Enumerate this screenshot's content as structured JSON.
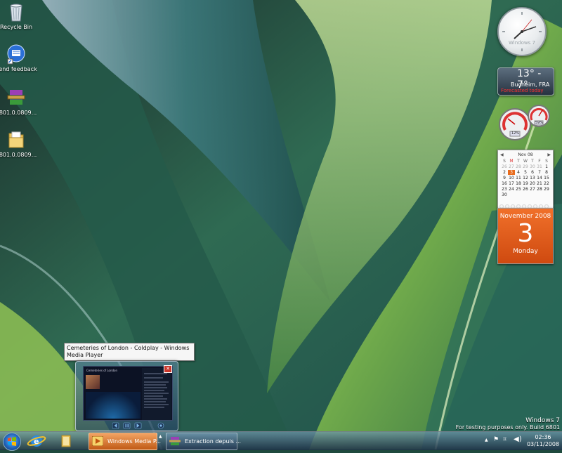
{
  "desktop": {
    "icons": [
      {
        "label": "Recycle Bin",
        "icon": "recycle-bin-icon"
      },
      {
        "label": "Send feedback",
        "icon": "feedback-icon"
      },
      {
        "label": "6801.0.0809...",
        "icon": "winrar-icon"
      },
      {
        "label": "6801.0.0809...",
        "icon": "folder-icon"
      }
    ]
  },
  "gadgets": {
    "clock": {
      "brand": "Windows 7"
    },
    "weather": {
      "temp": "13° - 7°",
      "location": "Bucheim, FRA",
      "forecast": "Forecasted today"
    },
    "meter": {
      "cpu_percent": "12%",
      "mem_percent": "59%"
    },
    "calendar": {
      "month": "Nov 08",
      "weekdays": [
        "S",
        "M",
        "T",
        "W",
        "T",
        "F",
        "S"
      ],
      "rows": [
        [
          "26",
          "27",
          "28",
          "29",
          "30",
          "31",
          "1"
        ],
        [
          "2",
          "3",
          "4",
          "5",
          "6",
          "7",
          "8"
        ],
        [
          "9",
          "10",
          "11",
          "12",
          "13",
          "14",
          "15"
        ],
        [
          "16",
          "17",
          "18",
          "19",
          "20",
          "21",
          "22"
        ],
        [
          "23",
          "24",
          "25",
          "26",
          "27",
          "28",
          "29"
        ],
        [
          "30",
          "",
          "",
          "",
          "",
          "",
          ""
        ]
      ],
      "page_month": "November 2008",
      "page_day": "3",
      "page_weekday": "Monday"
    }
  },
  "preview": {
    "tooltip": "Cemeteries of London - Coldplay - Windows Media Player",
    "screen_title": "Cemeteries of London"
  },
  "watermark": {
    "line1": "Windows 7",
    "line2": "For testing purposes only. Build 6801"
  },
  "taskbar": {
    "tasks": [
      {
        "label": "Windows Media P...",
        "icon": "media-player-icon"
      },
      {
        "label": "Extraction depuis ...",
        "icon": "winrar-icon"
      }
    ],
    "tray": {
      "time": "02:36",
      "date": "03/11/2008"
    }
  },
  "colors": {
    "accent_orange": "#e86c1d",
    "taskbar_active": "#d9782e"
  }
}
